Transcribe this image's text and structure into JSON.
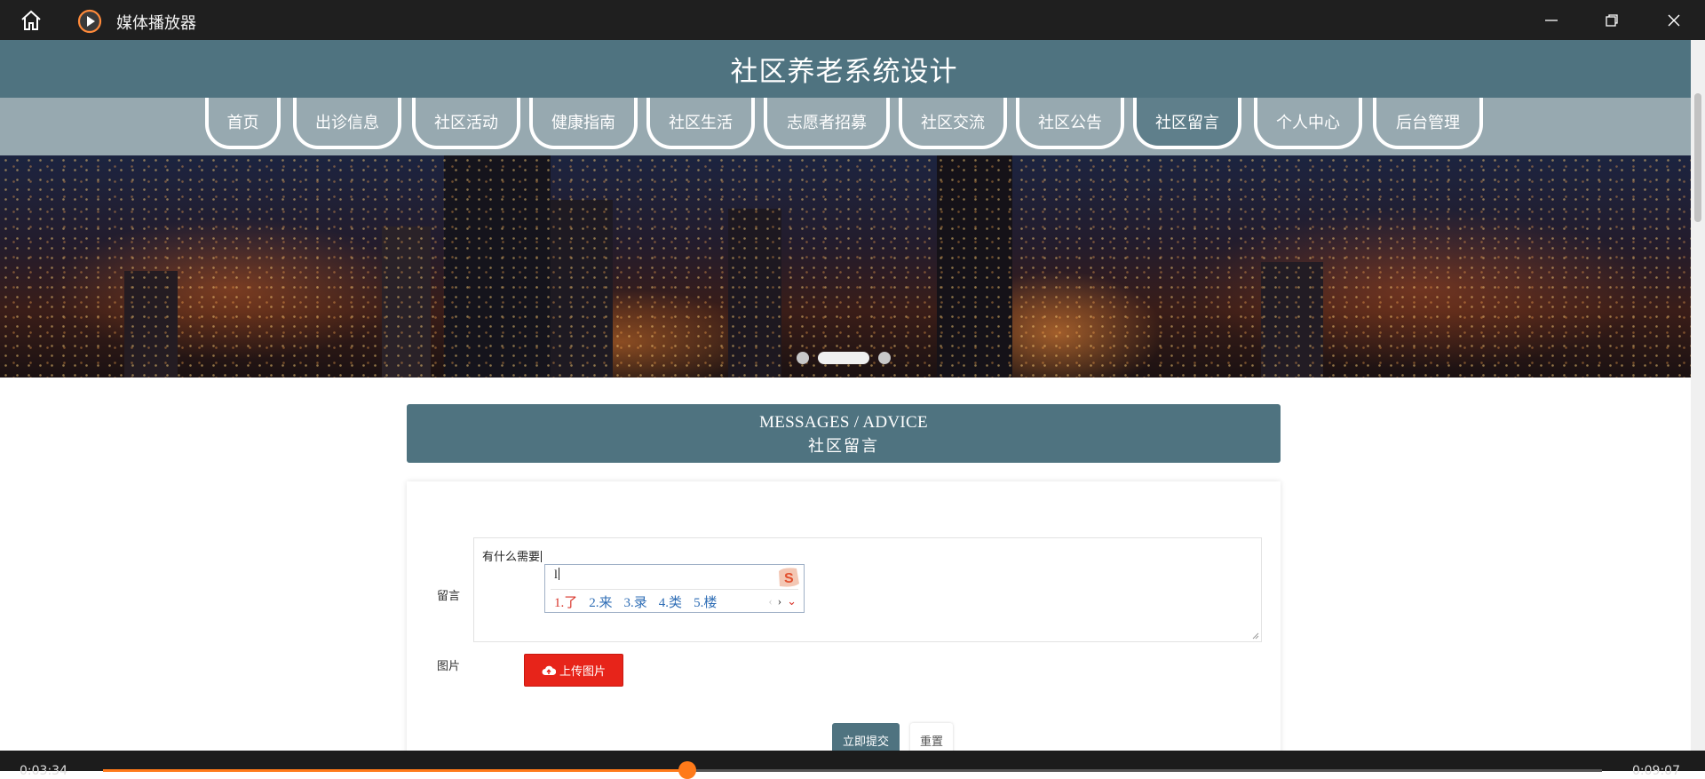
{
  "window": {
    "title": "媒体播放器",
    "icons": {
      "home": "home-icon",
      "app": "play-icon",
      "minimize": "minimize-icon",
      "maximize": "restore-icon",
      "close": "close-icon"
    }
  },
  "site": {
    "title": "社区养老系统设计",
    "accent_color": "#4f7380"
  },
  "nav": {
    "items": [
      {
        "label": "首页"
      },
      {
        "label": "出诊信息"
      },
      {
        "label": "社区活动"
      },
      {
        "label": "健康指南"
      },
      {
        "label": "社区生活"
      },
      {
        "label": "志愿者招募"
      },
      {
        "label": "社区交流"
      },
      {
        "label": "社区公告"
      },
      {
        "label": "社区留言",
        "active": true
      },
      {
        "label": "个人中心"
      },
      {
        "label": "后台管理"
      }
    ]
  },
  "banner": {
    "slide_count": 3,
    "active_slide": 2
  },
  "section": {
    "title_en": "MESSAGES / ADVICE",
    "title_cn": "社区留言"
  },
  "form": {
    "message_label": "留言",
    "message_value": "有什么需要",
    "image_label": "图片",
    "upload_button": "上传图片",
    "submit_button": "立即提交",
    "reset_button": "重置"
  },
  "ime": {
    "composition": "l",
    "candidates": [
      "1.了",
      "2.来",
      "3.录",
      "4.类",
      "5.楼"
    ],
    "logo": "sogou-s-icon"
  },
  "player": {
    "elapsed": "0:03:34",
    "duration": "0:09:07",
    "progress": 0.39,
    "color": "#ff7a1a"
  }
}
